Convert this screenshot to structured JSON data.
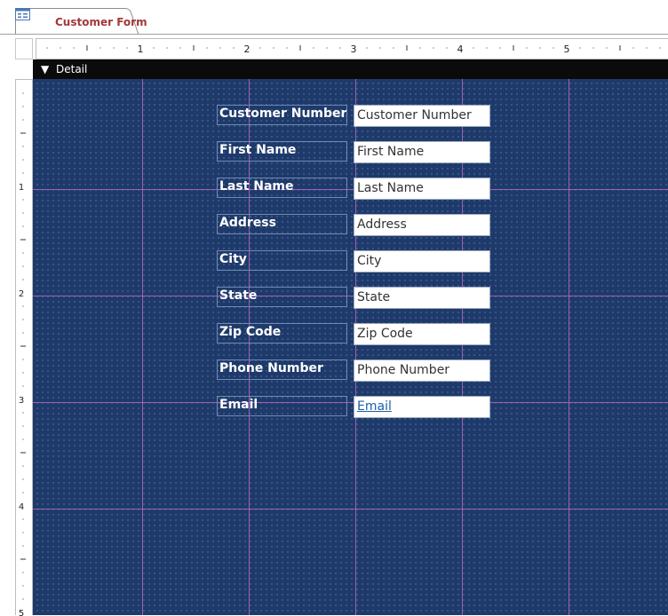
{
  "document_tab": {
    "title": "Customer Form",
    "icon": "form-icon"
  },
  "horizontal_ruler": {
    "numbers": [
      "1",
      "2",
      "3",
      "4",
      "5"
    ]
  },
  "vertical_ruler": {
    "numbers": [
      "1",
      "2",
      "3",
      "4",
      "5"
    ]
  },
  "section": {
    "label": "Detail",
    "icon": "section-arrow-icon"
  },
  "colors": {
    "tab_title": "#a4373a",
    "detail_background": "#1e3a6a",
    "grid_line": "#b565c4",
    "label_text": "#ffffff",
    "link_text": "#1b5fa8"
  },
  "fields": [
    {
      "label": "Customer Number",
      "textbox": "Customer Number",
      "is_link": false
    },
    {
      "label": "First Name",
      "textbox": "First Name",
      "is_link": false
    },
    {
      "label": "Last Name",
      "textbox": "Last Name",
      "is_link": false
    },
    {
      "label": "Address",
      "textbox": "Address",
      "is_link": false
    },
    {
      "label": "City",
      "textbox": "City",
      "is_link": false
    },
    {
      "label": "State",
      "textbox": "State",
      "is_link": false
    },
    {
      "label": "Zip Code",
      "textbox": "Zip Code",
      "is_link": false
    },
    {
      "label": "Phone Number",
      "textbox": "Phone Number",
      "is_link": false
    },
    {
      "label": "Email",
      "textbox": "Email",
      "is_link": true
    }
  ]
}
